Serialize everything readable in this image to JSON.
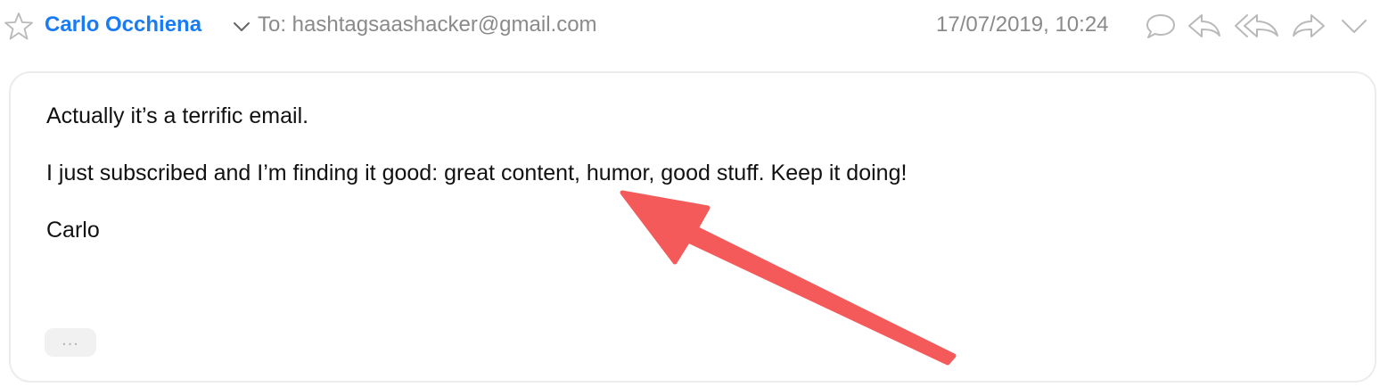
{
  "message": {
    "sender": "Carlo Occhiena",
    "recipient": "To: hashtagsaashacker@gmail.com",
    "timestamp": "17/07/2019, 10:24",
    "body": [
      "Actually it’s a terrific email.",
      "I just subscribed and I’m finding it good: great content, humor, good stuff. Keep it doing!",
      "Carlo"
    ],
    "show_more_label": "..."
  },
  "icons": {
    "star": "star-icon",
    "sender_menu": "chevron-down-icon",
    "reply_comment": "speech-bubble-icon",
    "reply": "reply-icon",
    "reply_all": "reply-all-icon",
    "forward": "forward-icon",
    "more_actions": "chevron-down-icon"
  },
  "colors": {
    "sender": "#1a7cf5",
    "meta_text": "#8a8a8a",
    "icon": "#b9b9b9",
    "annotation_arrow": "#f45a5a"
  }
}
